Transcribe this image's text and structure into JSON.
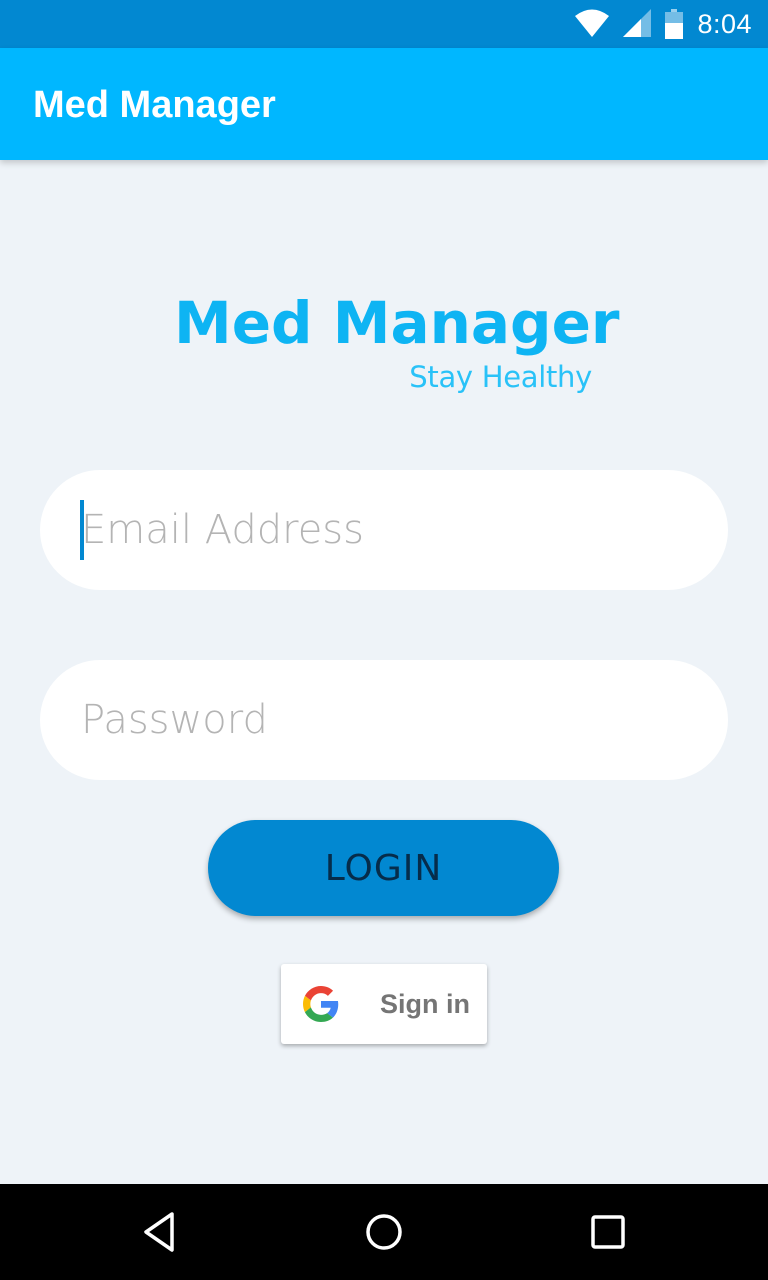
{
  "status_bar": {
    "time": "8:04",
    "icons": [
      "wifi-icon",
      "cellular-signal-icon",
      "battery-icon"
    ]
  },
  "app_bar": {
    "title": "Med Manager"
  },
  "logo": {
    "title": "Med Manager",
    "tagline": "Stay Healthy"
  },
  "login_form": {
    "email_placeholder": "Email Address",
    "email_value": "",
    "password_placeholder": "Password",
    "password_value": "",
    "login_label": "LOGIN"
  },
  "google_signin": {
    "label": "Sign in",
    "icon": "google-g-icon"
  },
  "nav_bar": {
    "icons": [
      "back-icon",
      "home-icon",
      "recents-icon"
    ]
  },
  "colors": {
    "status_bar": "#0288d1",
    "app_bar": "#00b7ff",
    "background": "#eef3f8",
    "logo_text": "#0eb4f3",
    "login_button": "#0288d1",
    "login_text": "#062c4a",
    "nav_bar": "#000000"
  }
}
